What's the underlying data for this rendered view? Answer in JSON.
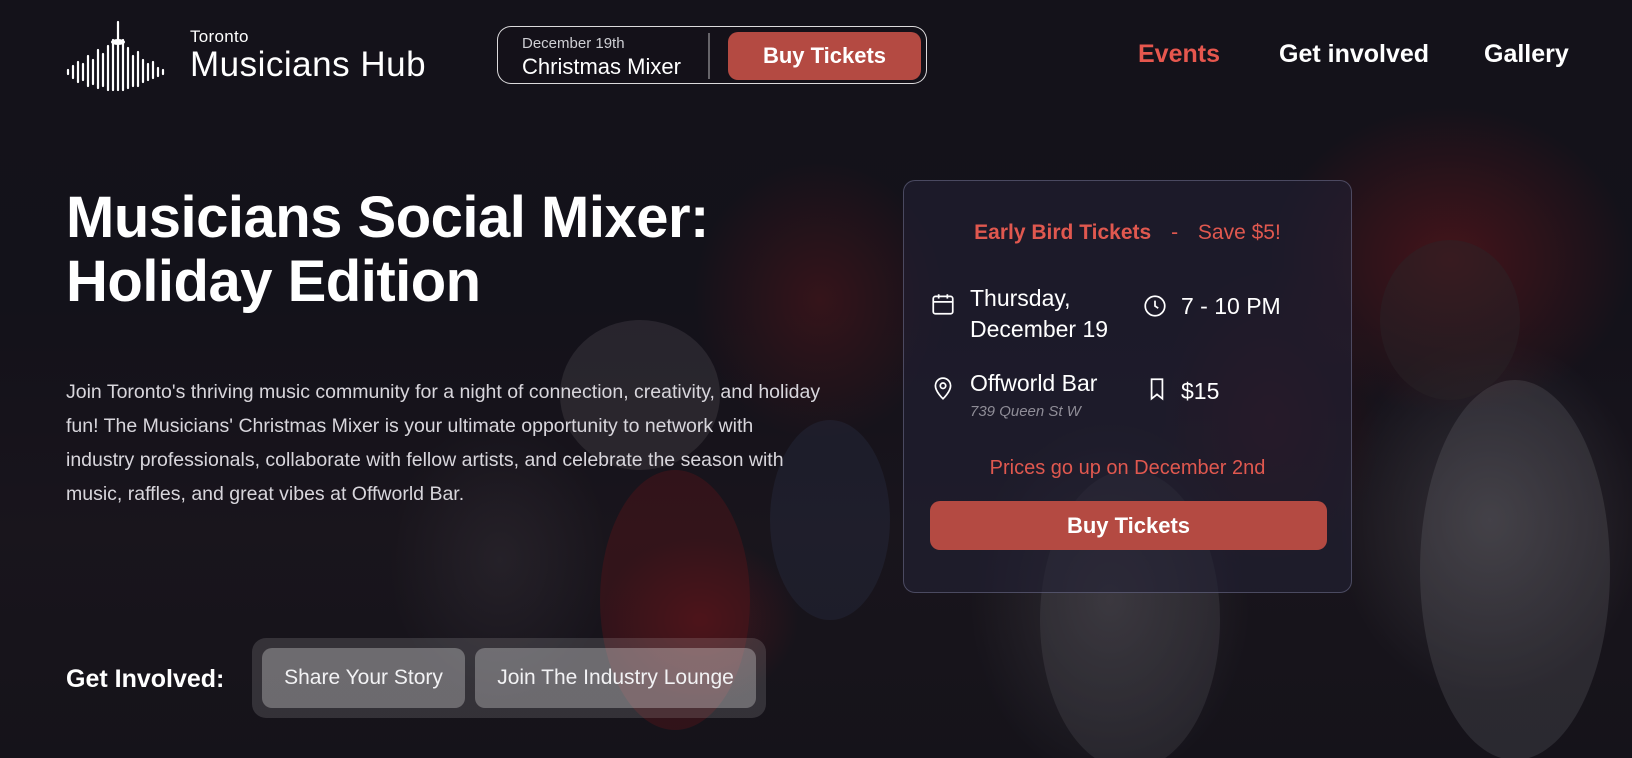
{
  "brand": {
    "small": "Toronto",
    "big": "Musicians Hub"
  },
  "promo": {
    "date": "December 19th",
    "name": "Christmas Mixer",
    "button": "Buy Tickets"
  },
  "nav": {
    "items": [
      "Events",
      "Get involved",
      "Gallery"
    ],
    "active_color": "#e6574e"
  },
  "hero": {
    "title_line1": "Musicians Social Mixer:",
    "title_line2": "Holiday Edition",
    "description": "Join Toronto's thriving music community for a night of connection, creativity, and holiday fun! The Musicians' Christmas Mixer is your ultimate opportunity to network with industry professionals, collaborate with fellow artists, and celebrate the season with music, raffles, and great vibes at Offworld Bar."
  },
  "ticket_card": {
    "early_bird": "Early Bird Tickets",
    "dash": "-",
    "save": "Save $5!",
    "date_line1": "Thursday,",
    "date_line2": "December 19",
    "time": "7 - 10 PM",
    "venue": "Offworld Bar",
    "address": "739 Queen St W",
    "price": "$15",
    "note": "Prices go up on December 2nd",
    "button": "Buy Tickets",
    "icons": [
      "calendar-icon",
      "clock-icon",
      "map-pin-icon",
      "bookmark-icon"
    ]
  },
  "get_involved": {
    "label": "Get Involved:",
    "buttons": [
      "Share Your Story",
      "Join The Industry Lounge"
    ]
  },
  "colors": {
    "accent": "#b44a42",
    "highlight": "#e0584f"
  }
}
